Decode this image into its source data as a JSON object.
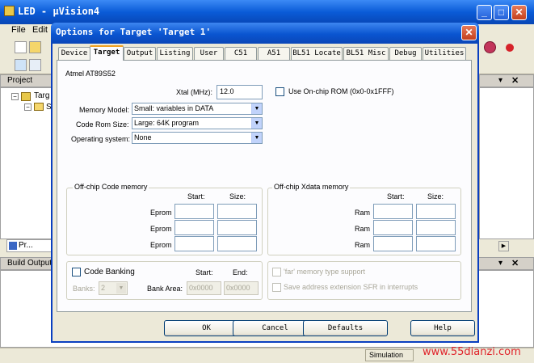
{
  "app": {
    "title": "LED  - μVision4",
    "menu": [
      "File",
      "Edit"
    ],
    "project_panel_title": "Project",
    "project_tree_root": "Targ",
    "project_tree_child": "S",
    "project_tab": "Pr...",
    "build_output_title": "Build Output",
    "status_simulation": "Simulation",
    "watermark": "www.55dianzi.com"
  },
  "dialog": {
    "title": "Options for Target 'Target 1'",
    "close_glyph": "✕",
    "tabs": [
      "Device",
      "Target",
      "Output",
      "Listing",
      "User",
      "C51",
      "A51",
      "BL51 Locate",
      "BL51 Misc",
      "Debug",
      "Utilities"
    ],
    "active_tab": "Target",
    "device_name": "Atmel AT89S52",
    "xtal_label": "Xtal (MHz):",
    "xtal_value": "12.0",
    "use_onchip_rom_label": "Use On-chip ROM (0x0-0x1FFF)",
    "memory_model_label": "Memory Model:",
    "memory_model_value": "Small: variables in DATA",
    "code_rom_size_label": "Code Rom Size:",
    "code_rom_size_value": "Large: 64K program",
    "operating_system_label": "Operating system:",
    "operating_system_value": "None",
    "offchip_code": {
      "title": "Off-chip Code memory",
      "start_label": "Start:",
      "size_label": "Size:",
      "rows": [
        "Eprom",
        "Eprom",
        "Eprom"
      ]
    },
    "offchip_xdata": {
      "title": "Off-chip Xdata memory",
      "start_label": "Start:",
      "size_label": "Size:",
      "rows": [
        "Ram",
        "Ram",
        "Ram"
      ]
    },
    "code_banking_label": "Code Banking",
    "bank_start_label": "Start:",
    "bank_end_label": "End:",
    "banks_label": "Banks:",
    "banks_value": "2",
    "bank_area_label": "Bank Area:",
    "bank_area_start": "0x0000",
    "bank_area_end": "0x0000",
    "far_memory_label": "'far' memory type support",
    "save_address_label": "Save address extension SFR in interrupts",
    "buttons": {
      "ok": "OK",
      "cancel": "Cancel",
      "defaults": "Defaults",
      "help": "Help"
    }
  }
}
